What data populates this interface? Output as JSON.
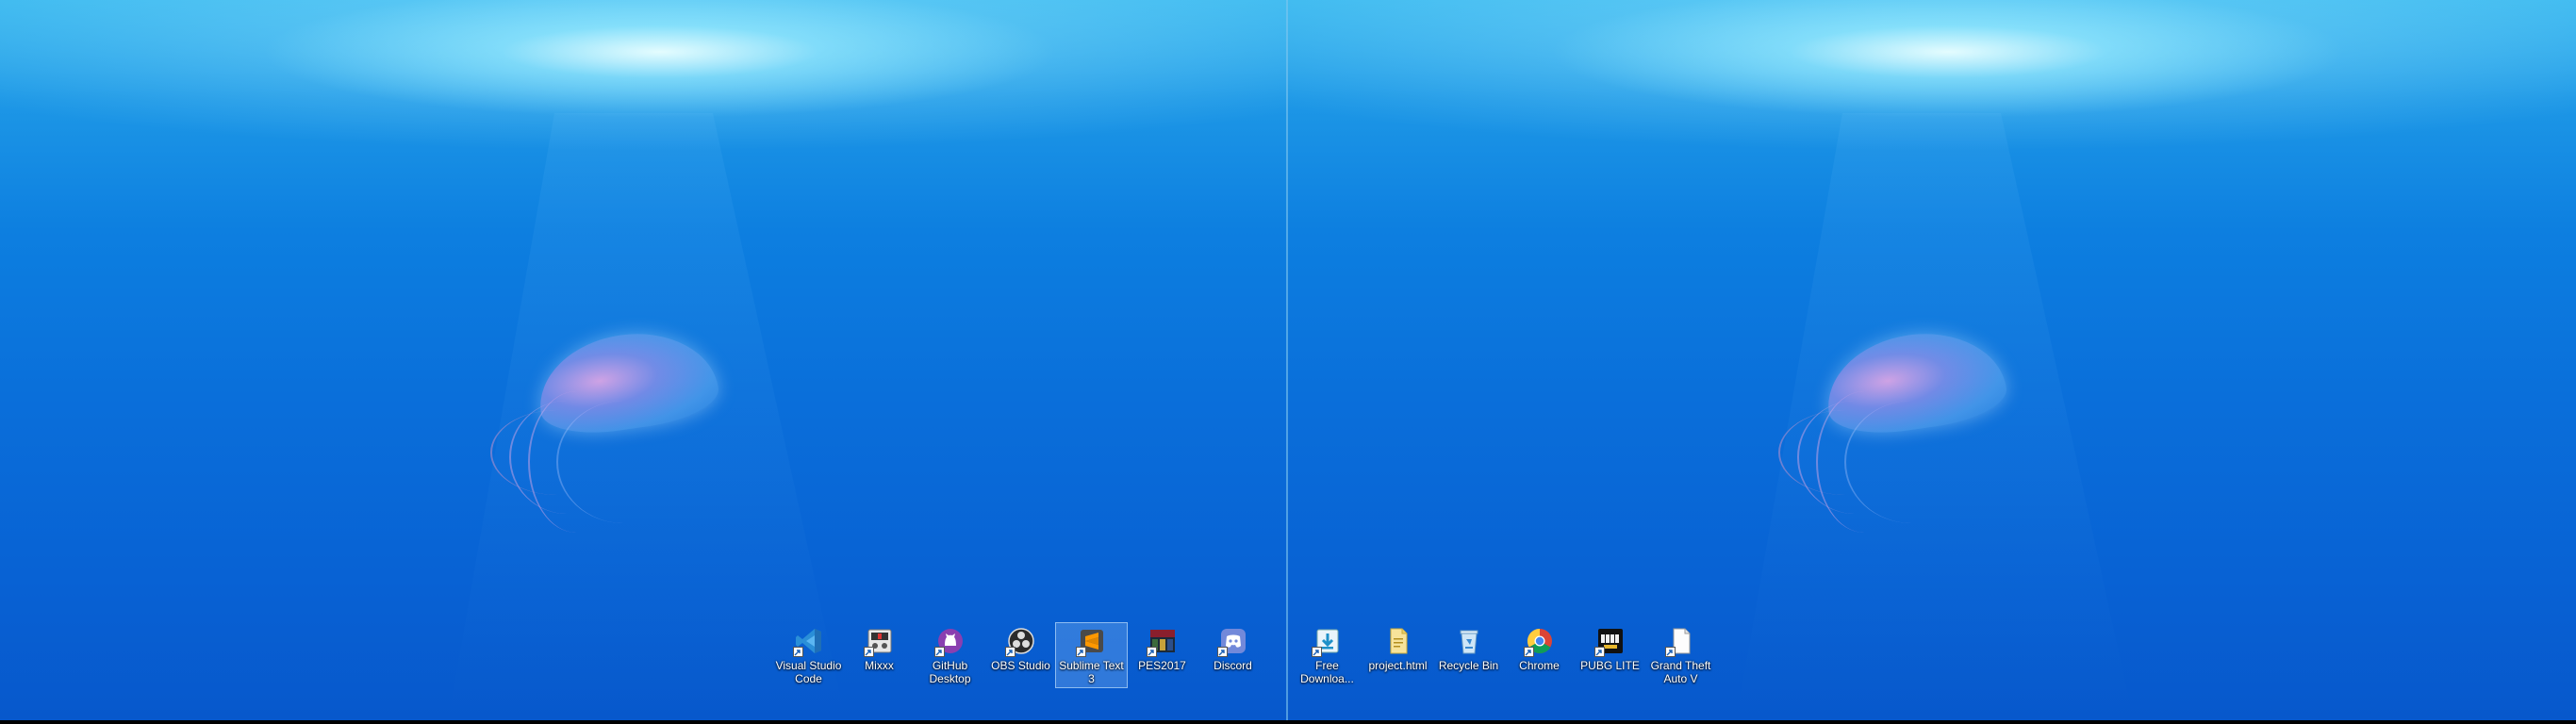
{
  "desktop": {
    "left_icons": [
      {
        "name": "visual-studio-code",
        "label": "Visual Studio Code",
        "icon": "vscode-icon",
        "selected": false
      },
      {
        "name": "mixxx",
        "label": "Mixxx",
        "icon": "mixxx-icon",
        "selected": false
      },
      {
        "name": "github-desktop",
        "label": "GitHub Desktop",
        "icon": "github-desktop-icon",
        "selected": false
      },
      {
        "name": "obs-studio",
        "label": "OBS Studio",
        "icon": "obs-studio-icon",
        "selected": false
      },
      {
        "name": "sublime-text-3",
        "label": "Sublime Text 3",
        "icon": "sublime-text-icon",
        "selected": true
      },
      {
        "name": "pes2017",
        "label": "PES2017",
        "icon": "pes2017-icon",
        "selected": false
      },
      {
        "name": "discord",
        "label": "Discord",
        "icon": "discord-icon",
        "selected": false
      }
    ],
    "right_icons": [
      {
        "name": "free-download",
        "label": "Free Downloa...",
        "icon": "free-download-manager-icon",
        "selected": false
      },
      {
        "name": "project-html",
        "label": "project.html",
        "icon": "html-file-icon",
        "selected": false
      },
      {
        "name": "recycle-bin",
        "label": "Recycle Bin",
        "icon": "recycle-bin-icon",
        "selected": false
      },
      {
        "name": "chrome",
        "label": "Chrome",
        "icon": "chrome-icon",
        "selected": false
      },
      {
        "name": "pubg-lite",
        "label": "PUBG LITE",
        "icon": "pubg-lite-icon",
        "selected": false
      },
      {
        "name": "gta-v",
        "label": "Grand Theft Auto V",
        "icon": "document-icon",
        "selected": false
      }
    ]
  },
  "colors": {
    "wallpaper_top": "#3ab8ef",
    "wallpaper_bottom": "#0758cc",
    "label_text": "#ffffff",
    "selection": "#aad2ff"
  }
}
